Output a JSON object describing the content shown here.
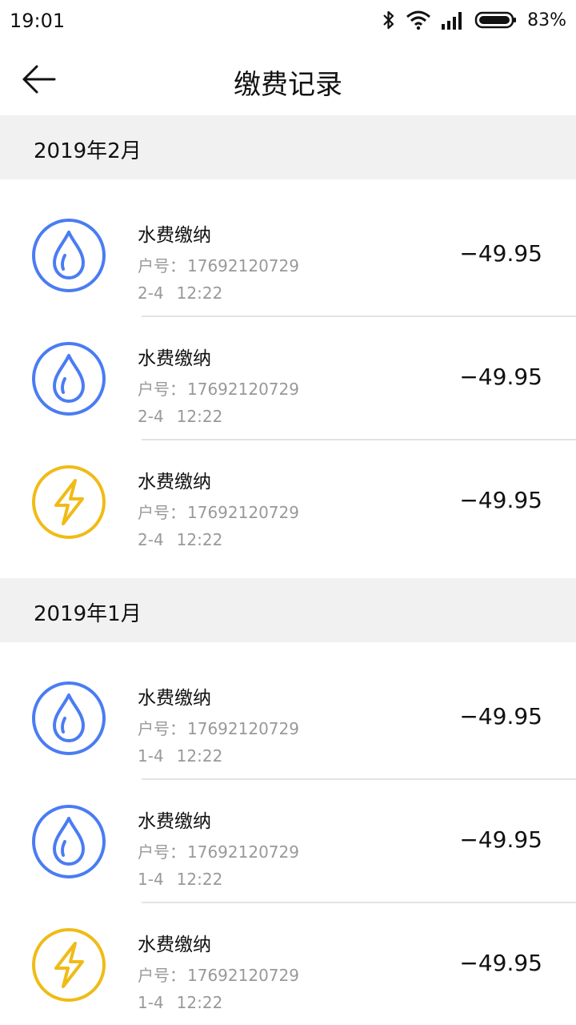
{
  "status_bar": {
    "time": "19:01",
    "battery": "83%"
  },
  "header": {
    "title": "缴费记录"
  },
  "colors": {
    "water": "#4a7cf3",
    "electric": "#f0bb16",
    "section_bg": "#f1f1f1"
  },
  "sections": [
    {
      "label": "2019年2月",
      "records": [
        {
          "type": "water-drop-icon",
          "name": "水费缴纳",
          "account_label": "户号：",
          "account": "17692120729",
          "date": "2-4",
          "time": "12:22",
          "amount": "−49.95"
        },
        {
          "type": "water-drop-icon",
          "name": "水费缴纳",
          "account_label": "户号：",
          "account": "17692120729",
          "date": "2-4",
          "time": "12:22",
          "amount": "−49.95"
        },
        {
          "type": "lightning-bolt-icon",
          "name": "水费缴纳",
          "account_label": "户号：",
          "account": "17692120729",
          "date": "2-4",
          "time": "12:22",
          "amount": "−49.95"
        }
      ]
    },
    {
      "label": "2019年1月",
      "records": [
        {
          "type": "water-drop-icon",
          "name": "水费缴纳",
          "account_label": "户号：",
          "account": "17692120729",
          "date": "1-4",
          "time": "12:22",
          "amount": "−49.95"
        },
        {
          "type": "water-drop-icon",
          "name": "水费缴纳",
          "account_label": "户号：",
          "account": "17692120729",
          "date": "1-4",
          "time": "12:22",
          "amount": "−49.95"
        },
        {
          "type": "lightning-bolt-icon",
          "name": "水费缴纳",
          "account_label": "户号：",
          "account": "17692120729",
          "date": "1-4",
          "time": "12:22",
          "amount": "−49.95"
        }
      ]
    }
  ]
}
